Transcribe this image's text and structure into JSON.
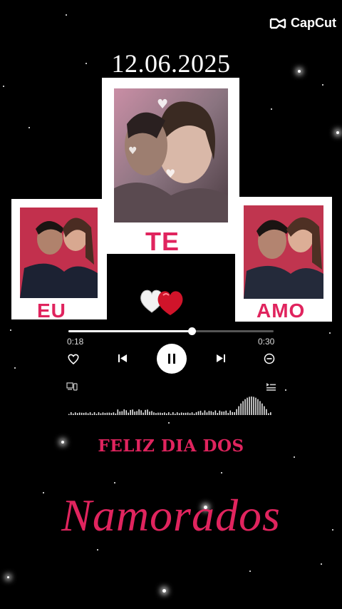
{
  "watermark": {
    "label": "CapCut",
    "icon": "capcut-logo-icon"
  },
  "date": "12.06.2025",
  "words": {
    "left": "EU",
    "center": "TE",
    "right": "AMO"
  },
  "player": {
    "elapsed": "0:18",
    "total": "0:30",
    "progress": 0.6,
    "icons": [
      "heart-outline-icon",
      "previous-icon",
      "pause-icon",
      "next-icon",
      "remove-icon",
      "device-icon",
      "queue-icon"
    ]
  },
  "message": {
    "line1": "FELIZ DIA DOS",
    "line2": "Namorados"
  },
  "colors": {
    "accent": "#e0245e",
    "background": "#000000",
    "frame": "#ffffff"
  }
}
